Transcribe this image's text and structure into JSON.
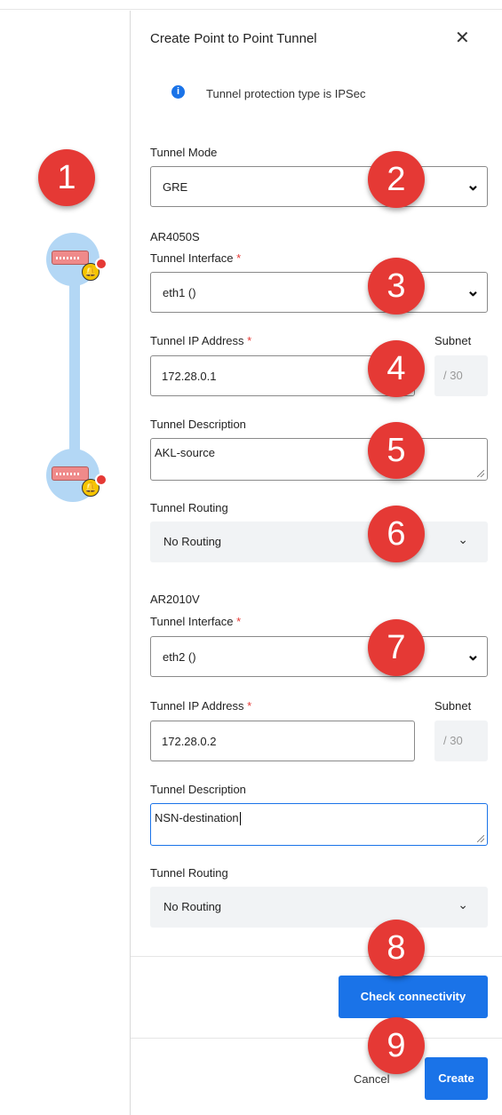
{
  "panel": {
    "title": "Create Point to Point Tunnel",
    "close_glyph": "✕",
    "info_icon": "i",
    "info_text": "Tunnel protection type is IPSec"
  },
  "tunnel_mode": {
    "label": "Tunnel Mode",
    "value": "GRE"
  },
  "device_a": {
    "name": "AR4050S",
    "interface_label": "Tunnel Interface",
    "interface_value": "eth1 ()",
    "ip_label": "Tunnel IP Address",
    "ip_value": "172.28.0.1",
    "subnet_label": "Subnet",
    "subnet_value": "/ 30",
    "description_label": "Tunnel Description",
    "description_value": "AKL-source",
    "routing_label": "Tunnel Routing",
    "routing_value": "No Routing"
  },
  "device_b": {
    "name": "AR2010V",
    "interface_label": "Tunnel Interface",
    "interface_value": "eth2 ()",
    "ip_label": "Tunnel IP Address",
    "ip_value": "172.28.0.2",
    "subnet_label": "Subnet",
    "subnet_value": "/ 30",
    "description_label": "Tunnel Description",
    "description_value": "NSN-destination",
    "routing_label": "Tunnel Routing",
    "routing_value": "No Routing"
  },
  "required_marker": "*",
  "actions": {
    "check_connectivity": "Check connectivity",
    "cancel": "Cancel",
    "create": "Create"
  },
  "badges": [
    "1",
    "2",
    "3",
    "4",
    "5",
    "6",
    "7",
    "8",
    "9"
  ],
  "glyphs": {
    "chevron_bold": "❯",
    "chevron_small": "⌄",
    "bell": "🔔"
  },
  "colors": {
    "accent": "#1a73e8",
    "badge": "#e53935",
    "link": "#b3d7f5"
  }
}
